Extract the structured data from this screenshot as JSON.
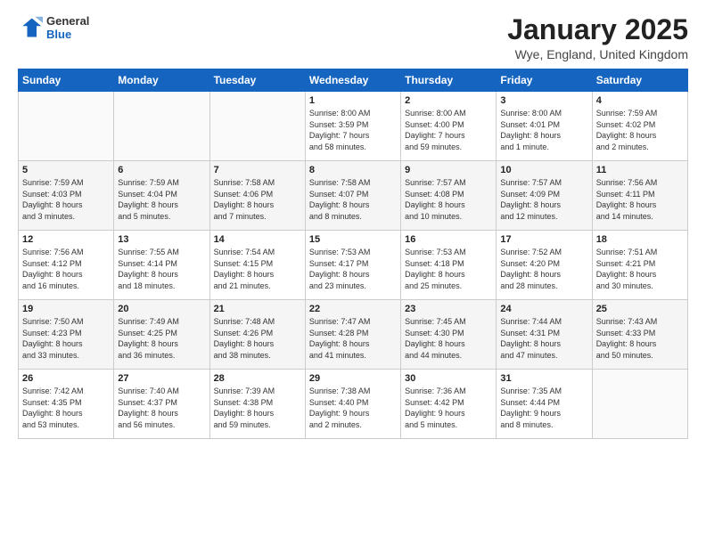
{
  "header": {
    "logo_general": "General",
    "logo_blue": "Blue",
    "month_title": "January 2025",
    "location": "Wye, England, United Kingdom"
  },
  "weekdays": [
    "Sunday",
    "Monday",
    "Tuesday",
    "Wednesday",
    "Thursday",
    "Friday",
    "Saturday"
  ],
  "weeks": [
    [
      {
        "day": "",
        "info": ""
      },
      {
        "day": "",
        "info": ""
      },
      {
        "day": "",
        "info": ""
      },
      {
        "day": "1",
        "info": "Sunrise: 8:00 AM\nSunset: 3:59 PM\nDaylight: 7 hours\nand 58 minutes."
      },
      {
        "day": "2",
        "info": "Sunrise: 8:00 AM\nSunset: 4:00 PM\nDaylight: 7 hours\nand 59 minutes."
      },
      {
        "day": "3",
        "info": "Sunrise: 8:00 AM\nSunset: 4:01 PM\nDaylight: 8 hours\nand 1 minute."
      },
      {
        "day": "4",
        "info": "Sunrise: 7:59 AM\nSunset: 4:02 PM\nDaylight: 8 hours\nand 2 minutes."
      }
    ],
    [
      {
        "day": "5",
        "info": "Sunrise: 7:59 AM\nSunset: 4:03 PM\nDaylight: 8 hours\nand 3 minutes."
      },
      {
        "day": "6",
        "info": "Sunrise: 7:59 AM\nSunset: 4:04 PM\nDaylight: 8 hours\nand 5 minutes."
      },
      {
        "day": "7",
        "info": "Sunrise: 7:58 AM\nSunset: 4:06 PM\nDaylight: 8 hours\nand 7 minutes."
      },
      {
        "day": "8",
        "info": "Sunrise: 7:58 AM\nSunset: 4:07 PM\nDaylight: 8 hours\nand 8 minutes."
      },
      {
        "day": "9",
        "info": "Sunrise: 7:57 AM\nSunset: 4:08 PM\nDaylight: 8 hours\nand 10 minutes."
      },
      {
        "day": "10",
        "info": "Sunrise: 7:57 AM\nSunset: 4:09 PM\nDaylight: 8 hours\nand 12 minutes."
      },
      {
        "day": "11",
        "info": "Sunrise: 7:56 AM\nSunset: 4:11 PM\nDaylight: 8 hours\nand 14 minutes."
      }
    ],
    [
      {
        "day": "12",
        "info": "Sunrise: 7:56 AM\nSunset: 4:12 PM\nDaylight: 8 hours\nand 16 minutes."
      },
      {
        "day": "13",
        "info": "Sunrise: 7:55 AM\nSunset: 4:14 PM\nDaylight: 8 hours\nand 18 minutes."
      },
      {
        "day": "14",
        "info": "Sunrise: 7:54 AM\nSunset: 4:15 PM\nDaylight: 8 hours\nand 21 minutes."
      },
      {
        "day": "15",
        "info": "Sunrise: 7:53 AM\nSunset: 4:17 PM\nDaylight: 8 hours\nand 23 minutes."
      },
      {
        "day": "16",
        "info": "Sunrise: 7:53 AM\nSunset: 4:18 PM\nDaylight: 8 hours\nand 25 minutes."
      },
      {
        "day": "17",
        "info": "Sunrise: 7:52 AM\nSunset: 4:20 PM\nDaylight: 8 hours\nand 28 minutes."
      },
      {
        "day": "18",
        "info": "Sunrise: 7:51 AM\nSunset: 4:21 PM\nDaylight: 8 hours\nand 30 minutes."
      }
    ],
    [
      {
        "day": "19",
        "info": "Sunrise: 7:50 AM\nSunset: 4:23 PM\nDaylight: 8 hours\nand 33 minutes."
      },
      {
        "day": "20",
        "info": "Sunrise: 7:49 AM\nSunset: 4:25 PM\nDaylight: 8 hours\nand 36 minutes."
      },
      {
        "day": "21",
        "info": "Sunrise: 7:48 AM\nSunset: 4:26 PM\nDaylight: 8 hours\nand 38 minutes."
      },
      {
        "day": "22",
        "info": "Sunrise: 7:47 AM\nSunset: 4:28 PM\nDaylight: 8 hours\nand 41 minutes."
      },
      {
        "day": "23",
        "info": "Sunrise: 7:45 AM\nSunset: 4:30 PM\nDaylight: 8 hours\nand 44 minutes."
      },
      {
        "day": "24",
        "info": "Sunrise: 7:44 AM\nSunset: 4:31 PM\nDaylight: 8 hours\nand 47 minutes."
      },
      {
        "day": "25",
        "info": "Sunrise: 7:43 AM\nSunset: 4:33 PM\nDaylight: 8 hours\nand 50 minutes."
      }
    ],
    [
      {
        "day": "26",
        "info": "Sunrise: 7:42 AM\nSunset: 4:35 PM\nDaylight: 8 hours\nand 53 minutes."
      },
      {
        "day": "27",
        "info": "Sunrise: 7:40 AM\nSunset: 4:37 PM\nDaylight: 8 hours\nand 56 minutes."
      },
      {
        "day": "28",
        "info": "Sunrise: 7:39 AM\nSunset: 4:38 PM\nDaylight: 8 hours\nand 59 minutes."
      },
      {
        "day": "29",
        "info": "Sunrise: 7:38 AM\nSunset: 4:40 PM\nDaylight: 9 hours\nand 2 minutes."
      },
      {
        "day": "30",
        "info": "Sunrise: 7:36 AM\nSunset: 4:42 PM\nDaylight: 9 hours\nand 5 minutes."
      },
      {
        "day": "31",
        "info": "Sunrise: 7:35 AM\nSunset: 4:44 PM\nDaylight: 9 hours\nand 8 minutes."
      },
      {
        "day": "",
        "info": ""
      }
    ]
  ]
}
